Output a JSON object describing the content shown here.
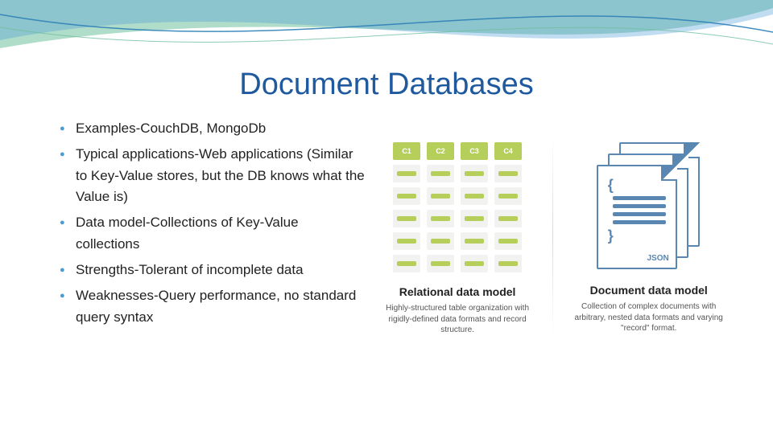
{
  "title": "Document Databases",
  "bullets": [
    "Examples-CouchDB, MongoDb",
    "Typical applications-Web applications (Similar to Key-Value stores, but the DB knows what the Value is)",
    "Data model-Collections of Key-Value collections",
    "Strengths-Tolerant of incomplete data",
    "Weaknesses-Query performance, no standard query syntax"
  ],
  "relational": {
    "headers": [
      "C1",
      "C2",
      "C3",
      "C4"
    ],
    "rows": 5,
    "label": "Relational data model",
    "desc": "Highly-structured table organization with rigidly-defined data formats and record structure."
  },
  "document": {
    "json_tag": "JSON",
    "label": "Document data model",
    "desc": "Collection of complex documents with arbitrary, nested data formats and varying \"record\" format."
  }
}
